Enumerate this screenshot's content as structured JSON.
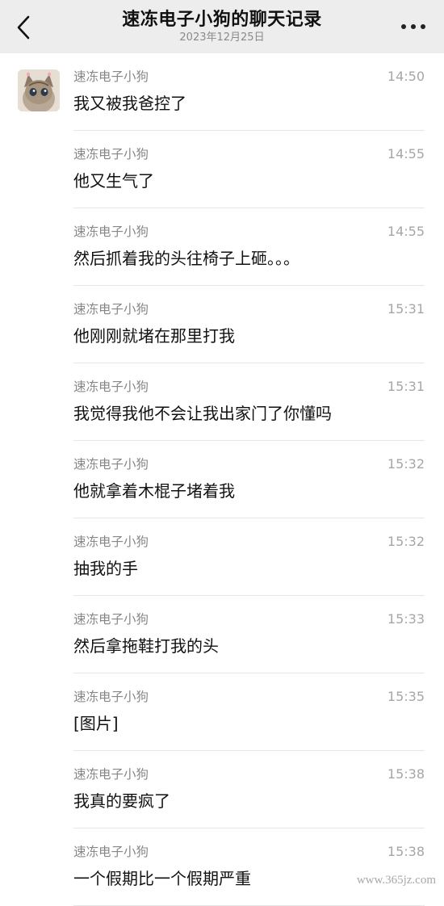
{
  "header": {
    "title": "速冻电子小狗的聊天记录",
    "subtitle": "2023年12月25日"
  },
  "icons": {
    "back": "chevron-left-icon",
    "more": "more-dots-icon",
    "avatar": "cat-avatar"
  },
  "messages": [
    {
      "sender": "速冻电子小狗",
      "time": "14:50",
      "text": "我又被我爸控了",
      "avatar": true
    },
    {
      "sender": "速冻电子小狗",
      "time": "14:55",
      "text": "他又生气了"
    },
    {
      "sender": "速冻电子小狗",
      "time": "14:55",
      "text": "然后抓着我的头往椅子上砸。。。"
    },
    {
      "sender": "速冻电子小狗",
      "time": "15:31",
      "text": "他刚刚就堵在那里打我"
    },
    {
      "sender": "速冻电子小狗",
      "time": "15:31",
      "text": "我觉得我他不会让我出家门了你懂吗"
    },
    {
      "sender": "速冻电子小狗",
      "time": "15:32",
      "text": "他就拿着木棍子堵着我"
    },
    {
      "sender": "速冻电子小狗",
      "time": "15:32",
      "text": "抽我的手"
    },
    {
      "sender": "速冻电子小狗",
      "time": "15:33",
      "text": "然后拿拖鞋打我的头"
    },
    {
      "sender": "速冻电子小狗",
      "time": "15:35",
      "text": "[图片]"
    },
    {
      "sender": "速冻电子小狗",
      "time": "15:38",
      "text": "我真的要疯了"
    },
    {
      "sender": "速冻电子小狗",
      "time": "15:38",
      "text": "一个假期比一个假期严重"
    }
  ],
  "watermark": "www.365jz.com",
  "colors": {
    "header_bg": "#ededed",
    "page_bg": "#ffffff",
    "sender_text": "#878787",
    "time_text": "#a6a6a6",
    "divider": "#e5e5e5"
  }
}
